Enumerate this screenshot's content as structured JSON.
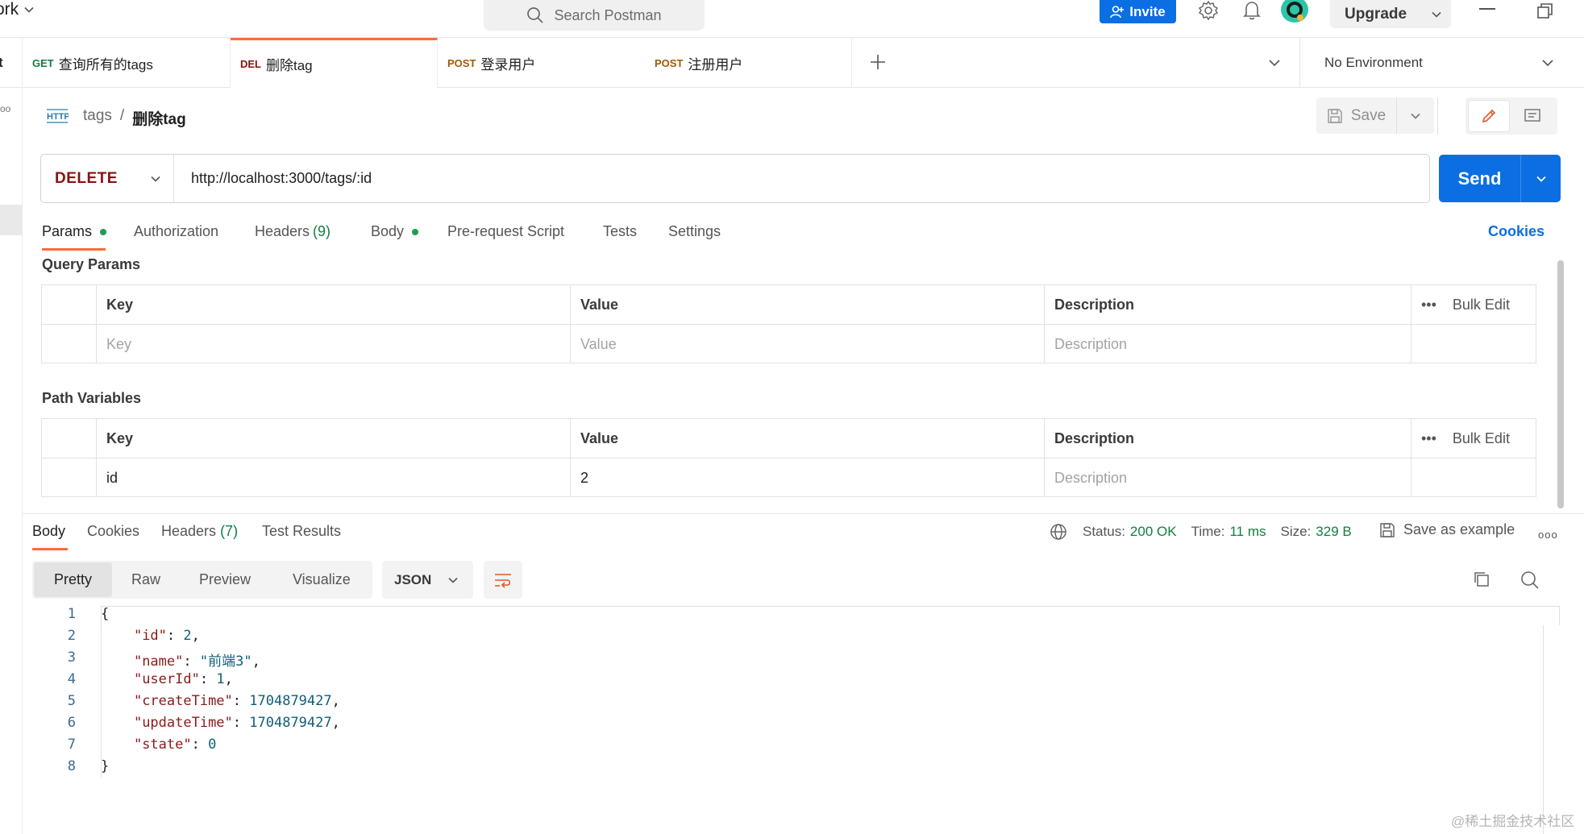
{
  "topbar": {
    "workspace_label": "ork",
    "search_placeholder": "Search Postman",
    "invite_label": "Invite",
    "upgrade_label": "Upgrade"
  },
  "tabs": {
    "fragment_label": "t",
    "items": [
      {
        "method": "GET",
        "name": "查询所有的tags"
      },
      {
        "method": "DEL",
        "name": "删除tag"
      },
      {
        "method": "POST",
        "name": "登录用户"
      },
      {
        "method": "POST",
        "name": "注册用户"
      }
    ],
    "environment": "No Environment"
  },
  "sidebar": {
    "dots": "oo"
  },
  "breadcrumb": {
    "collection": "tags",
    "separator": "/",
    "current": "删除tag",
    "save_label": "Save"
  },
  "request": {
    "method": "DELETE",
    "url": "http://localhost:3000/tags/:id",
    "send_label": "Send"
  },
  "request_tabs": {
    "params": "Params",
    "authorization": "Authorization",
    "headers": "Headers",
    "headers_count": "(9)",
    "body": "Body",
    "pre_request": "Pre-request Script",
    "tests": "Tests",
    "settings": "Settings",
    "cookies": "Cookies"
  },
  "query_params": {
    "title": "Query Params",
    "headers": [
      "Key",
      "Value",
      "Description"
    ],
    "bulk_edit": "Bulk Edit",
    "more": "•••",
    "placeholders": [
      "Key",
      "Value",
      "Description"
    ]
  },
  "path_variables": {
    "title": "Path Variables",
    "headers": [
      "Key",
      "Value",
      "Description"
    ],
    "bulk_edit": "Bulk Edit",
    "more": "•••",
    "rows": [
      {
        "key": "id",
        "value": "2",
        "description_placeholder": "Description"
      }
    ]
  },
  "response": {
    "tabs": {
      "body": "Body",
      "cookies": "Cookies",
      "headers": "Headers",
      "headers_count": "(7)",
      "test_results": "Test Results"
    },
    "status_label": "Status:",
    "status_value": "200 OK",
    "time_label": "Time:",
    "time_value": "11 ms",
    "size_label": "Size:",
    "size_value": "329 B",
    "save_example": "Save as example",
    "more": "ooo",
    "formats": [
      "Pretty",
      "Raw",
      "Preview",
      "Visualize"
    ],
    "language": "JSON",
    "code_lines": [
      {
        "n": "1",
        "text": "{"
      },
      {
        "n": "2",
        "key": "\"id\"",
        "value": "2",
        "trail": ","
      },
      {
        "n": "3",
        "key": "\"name\"",
        "value": "\"前端3\"",
        "trail": ","
      },
      {
        "n": "4",
        "key": "\"userId\"",
        "value": "1",
        "trail": ","
      },
      {
        "n": "5",
        "key": "\"createTime\"",
        "value": "1704879427",
        "trail": ","
      },
      {
        "n": "6",
        "key": "\"updateTime\"",
        "value": "1704879427",
        "trail": ","
      },
      {
        "n": "7",
        "key": "\"state\"",
        "value": "0",
        "trail": ""
      },
      {
        "n": "8",
        "text": "}"
      }
    ]
  },
  "watermark": "@稀土掘金技术社区",
  "colors": {
    "accent": "#ff6c37",
    "primary": "#0b6fe3",
    "success": "#0f7f3f",
    "delete_method": "#8a1212",
    "post_method": "#a05a00"
  }
}
